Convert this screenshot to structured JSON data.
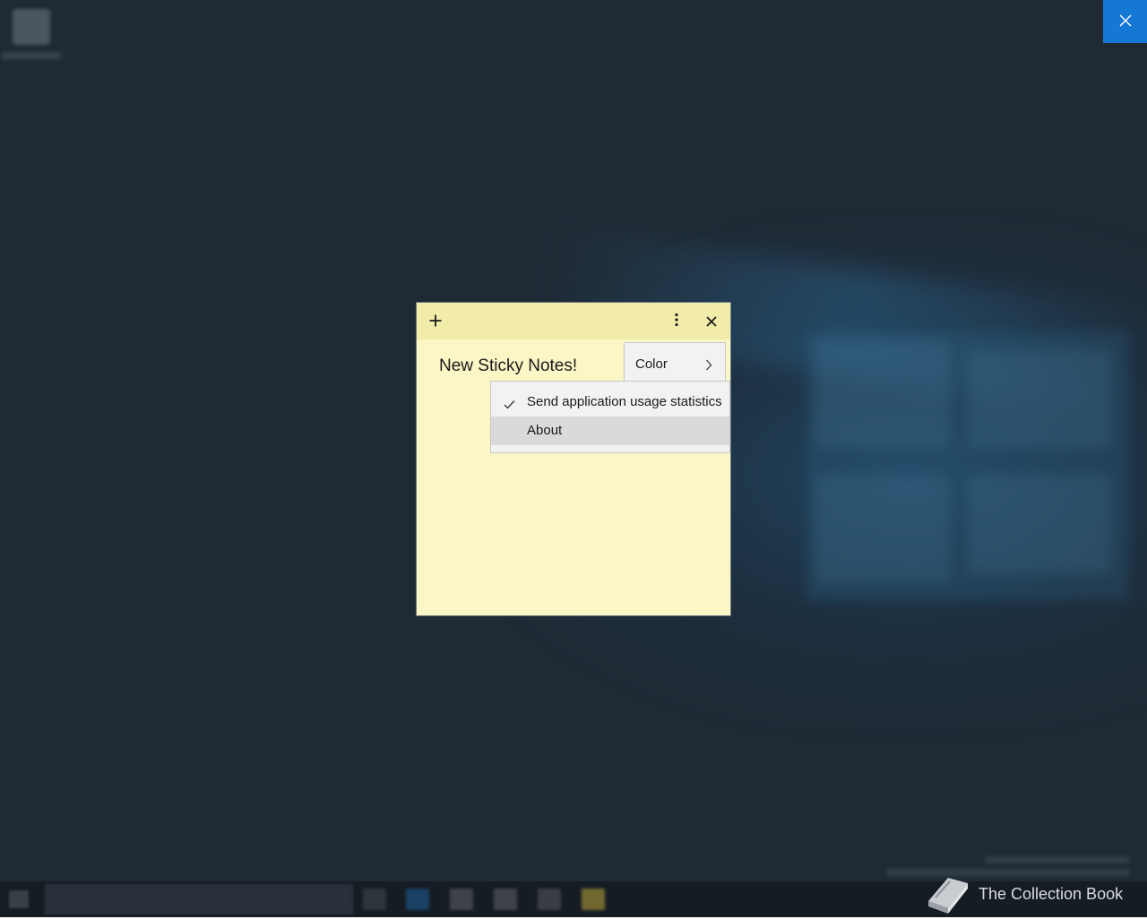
{
  "note": {
    "text": "New Sticky Notes!",
    "background_color": "#faf6c6",
    "header_color": "#f2ecab",
    "add_icon": "plus-icon",
    "menu_icon": "more-vertical-icon",
    "close_icon": "close-icon"
  },
  "menu": {
    "items": [
      {
        "label": "Color",
        "icon": "chevron-right-icon"
      }
    ]
  },
  "submenu": {
    "items": [
      {
        "label": "Send application usage statistics",
        "checked": true,
        "icon": "checkmark-icon"
      },
      {
        "label": "About",
        "highlighted": true
      }
    ]
  },
  "overlay": {
    "dismiss_icon": "close-icon",
    "accent_color": "#1578d4"
  },
  "watermark": {
    "text": "The Collection Book",
    "icon": "book-icon"
  }
}
